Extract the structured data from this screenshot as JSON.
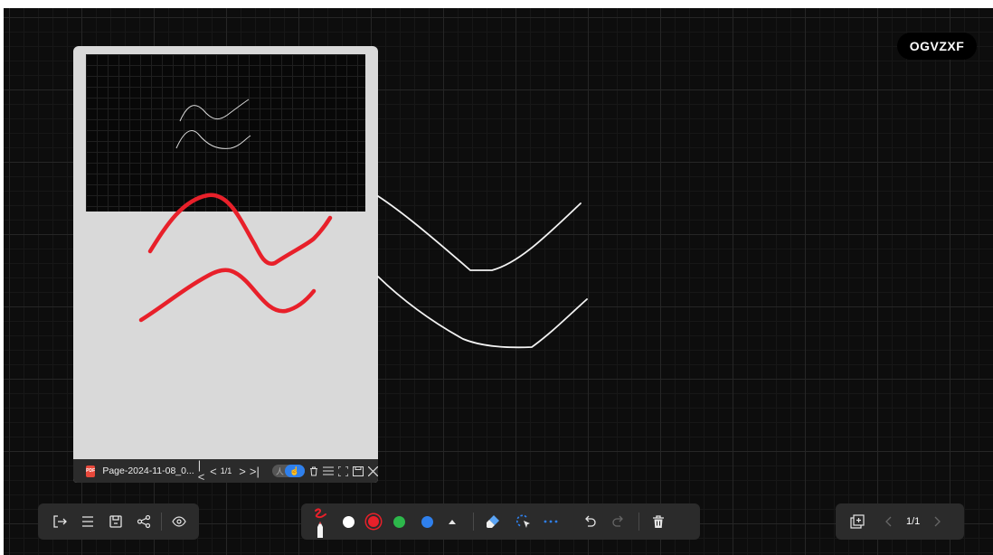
{
  "room": {
    "code": "OGVZXF"
  },
  "document": {
    "file_type": "PDF",
    "file_name": "Page-2024-11-08_0...",
    "page_indicator": "1/1",
    "mode_option_a": "人",
    "mode_option_b": "☝"
  },
  "toolbar_center": {
    "colors": [
      "#ffffff",
      "#e8202a",
      "#2db84b",
      "#2f80ed"
    ],
    "active_pen_color": "#e8202a"
  },
  "pagination": {
    "indicator": "1/1"
  },
  "theme": {
    "board_bg": "#0d0d0d",
    "toolbar_bg": "#2b2b2b",
    "accent": "#2f80ed",
    "stroke_red": "#e8202a"
  }
}
